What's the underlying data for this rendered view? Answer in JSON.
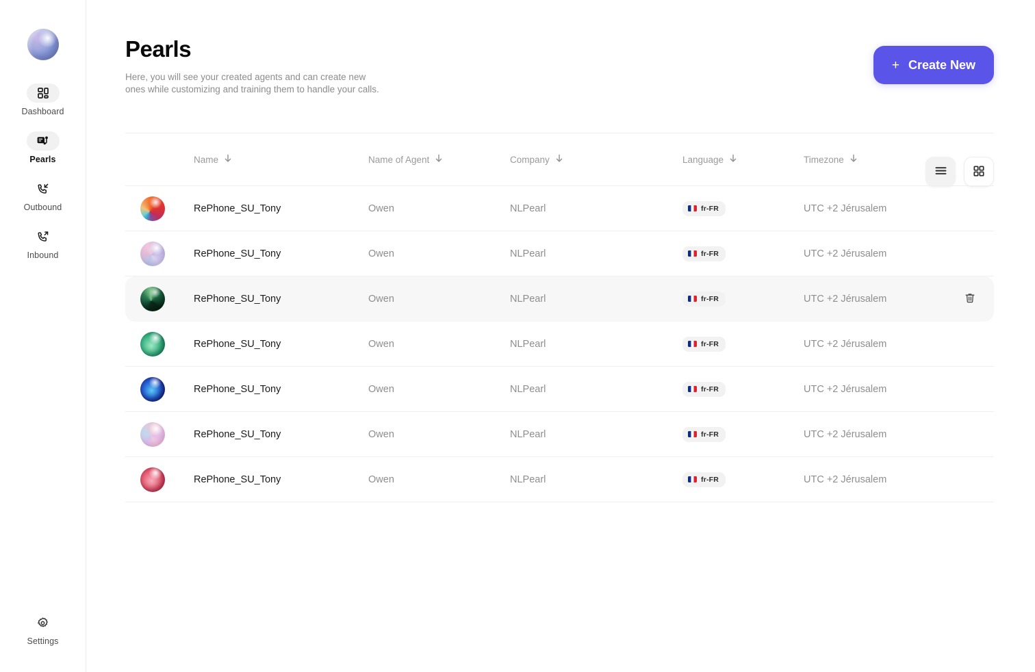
{
  "sidebar": {
    "logo_icon": "pearl-logo-icon",
    "items": [
      {
        "label": "Dashboard",
        "icon": "dashboard-grid-icon",
        "active": false
      },
      {
        "label": "Pearls",
        "icon": "pearls-agent-icon",
        "active": true
      },
      {
        "label": "Outbound",
        "icon": "phone-outgoing-icon",
        "active": false
      },
      {
        "label": "Inbound",
        "icon": "phone-incoming-icon",
        "active": false
      }
    ],
    "settings": {
      "label": "Settings",
      "icon": "gear-icon"
    }
  },
  "header": {
    "title": "Pearls",
    "subtitle": "Here, you will see your created agents and can create new ones while customizing and training them to handle your calls.",
    "create_button": {
      "label": "Create New",
      "icon": "plus-icon",
      "color": "#5a54e8"
    }
  },
  "view_toggle": {
    "list": {
      "name": "list-view",
      "icon": "list-icon",
      "active": true
    },
    "grid": {
      "name": "grid-view",
      "icon": "grid-icon",
      "active": false
    }
  },
  "table": {
    "columns": [
      {
        "label": "Name",
        "sort_icon": "arrow-down-icon"
      },
      {
        "label": "Name of Agent",
        "sort_icon": "arrow-down-icon"
      },
      {
        "label": "Company",
        "sort_icon": "arrow-down-icon"
      },
      {
        "label": "Language",
        "sort_icon": "arrow-down-icon"
      },
      {
        "label": "Timezone",
        "sort_icon": "arrow-down-icon"
      }
    ],
    "rows": [
      {
        "avatar": "pearl-red",
        "name": "RePhone_SU_Tony",
        "agent": "Owen",
        "company": "NLPearl",
        "language": "fr-FR",
        "flag": "france-flag-icon",
        "timezone": "UTC +2 Jérusalem",
        "hovered": false
      },
      {
        "avatar": "pearl-lavender",
        "name": "RePhone_SU_Tony",
        "agent": "Owen",
        "company": "NLPearl",
        "language": "fr-FR",
        "flag": "france-flag-icon",
        "timezone": "UTC +2 Jérusalem",
        "hovered": false
      },
      {
        "avatar": "pearl-dark-green",
        "name": "RePhone_SU_Tony",
        "agent": "Owen",
        "company": "NLPearl",
        "language": "fr-FR",
        "flag": "france-flag-icon",
        "timezone": "UTC +2 Jérusalem",
        "hovered": true
      },
      {
        "avatar": "pearl-green",
        "name": "RePhone_SU_Tony",
        "agent": "Owen",
        "company": "NLPearl",
        "language": "fr-FR",
        "flag": "france-flag-icon",
        "timezone": "UTC +2 Jérusalem",
        "hovered": false
      },
      {
        "avatar": "pearl-blue",
        "name": "RePhone_SU_Tony",
        "agent": "Owen",
        "company": "NLPearl",
        "language": "fr-FR",
        "flag": "france-flag-icon",
        "timezone": "UTC +2 Jérusalem",
        "hovered": false
      },
      {
        "avatar": "pearl-pink",
        "name": "RePhone_SU_Tony",
        "agent": "Owen",
        "company": "NLPearl",
        "language": "fr-FR",
        "flag": "france-flag-icon",
        "timezone": "UTC +2 Jérusalem",
        "hovered": false
      },
      {
        "avatar": "pearl-rose",
        "name": "RePhone_SU_Tony",
        "agent": "Owen",
        "company": "NLPearl",
        "language": "fr-FR",
        "flag": "france-flag-icon",
        "timezone": "UTC +2 Jérusalem",
        "hovered": false
      }
    ],
    "row_action": {
      "icon": "trash-icon",
      "name": "delete-row-button"
    }
  }
}
